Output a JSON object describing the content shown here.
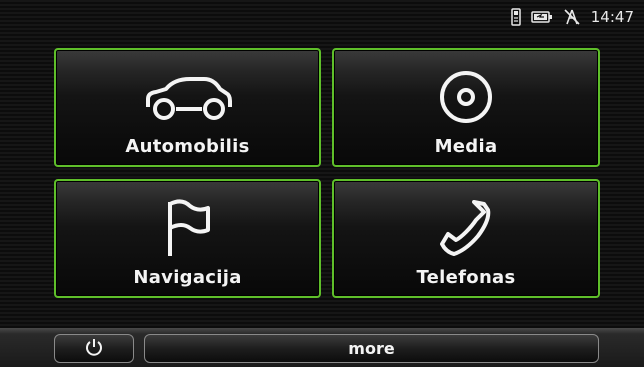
{
  "status": {
    "time": "14:47",
    "icons": [
      "phone-icon",
      "battery-icon",
      "no-signal-icon"
    ]
  },
  "tiles": [
    {
      "label": "Automobilis",
      "icon": "car-icon"
    },
    {
      "label": "Media",
      "icon": "disc-icon"
    },
    {
      "label": "Navigacija",
      "icon": "flag-icon"
    },
    {
      "label": "Telefonas",
      "icon": "phone-handset-icon"
    }
  ],
  "bottom": {
    "power_icon": "power-icon",
    "more_label": "more"
  },
  "colors": {
    "accent": "#5fbf2a",
    "background": "#111111",
    "text": "#f4f4f4"
  }
}
